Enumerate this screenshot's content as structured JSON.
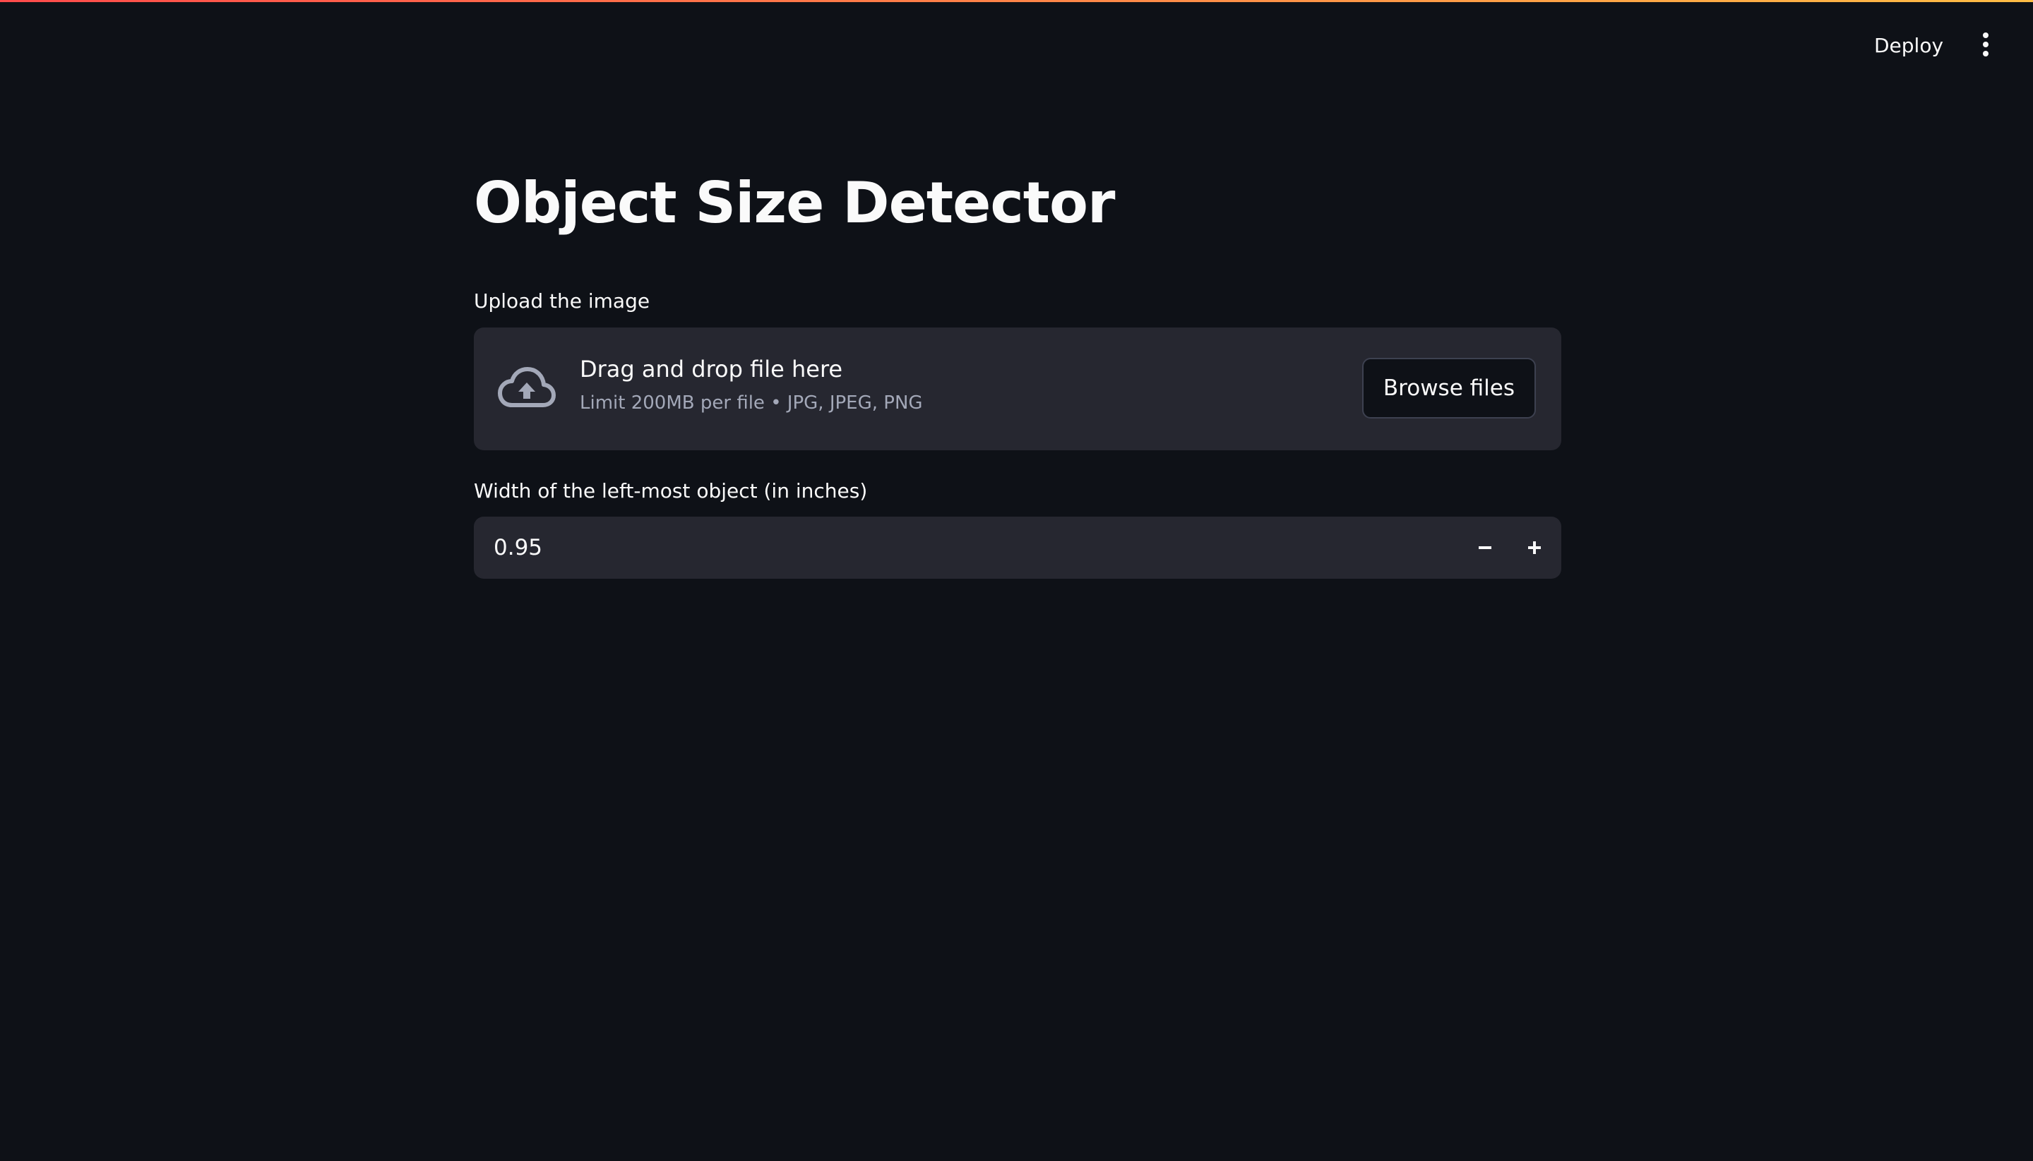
{
  "header": {
    "deploy_label": "Deploy",
    "menu_icon": "kebab-menu-icon"
  },
  "colors": {
    "background": "#0e1117",
    "surface": "#262730",
    "text": "#fafafa",
    "muted_text": "#a3a8b8",
    "accent_start": "#ff4b4b",
    "accent_end": "#ffbd45"
  },
  "main": {
    "title": "Object Size Detector",
    "uploader": {
      "label": "Upload the image",
      "icon": "cloud-upload-icon",
      "primary_text": "Drag and drop file here",
      "secondary_text": "Limit 200MB per file • JPG, JPEG, PNG",
      "browse_label": "Browse files"
    },
    "width_input": {
      "label": "Width of the left-most object (in inches)",
      "value": "0.95",
      "decrement_icon": "minus-icon",
      "increment_icon": "plus-icon"
    }
  }
}
